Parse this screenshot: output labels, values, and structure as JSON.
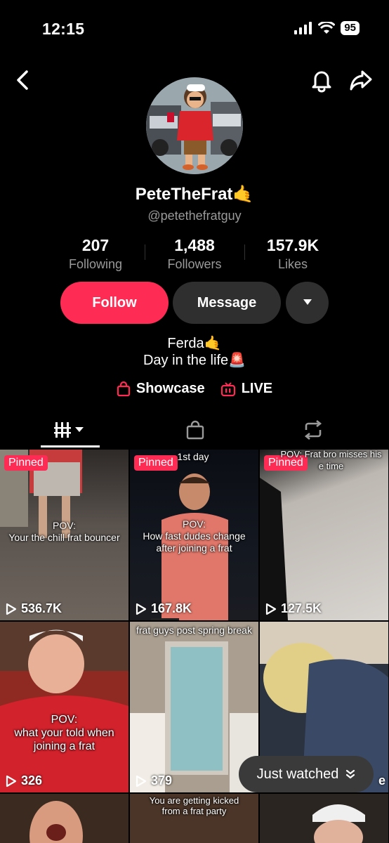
{
  "status": {
    "time": "12:15",
    "battery": "95"
  },
  "profile": {
    "username": "PeteTheFrat🤙",
    "handle": "@petethefratguy",
    "stats": [
      {
        "value": "207",
        "label": "Following"
      },
      {
        "value": "1,488",
        "label": "Followers"
      },
      {
        "value": "157.9K",
        "label": "Likes"
      }
    ],
    "follow_label": "Follow",
    "message_label": "Message",
    "bio_line1": "Ferda🤙",
    "bio_line2": "Day in the life🚨",
    "showcase_label": "Showcase",
    "live_label": "LIVE"
  },
  "colors": {
    "accent": "#fe2c55",
    "button_dark": "#2f2f2f",
    "muted": "#9a9a9a"
  },
  "videos": [
    {
      "pinned": "Pinned",
      "caption": "POV:\nYour the chill frat bouncer",
      "views": "536.7K"
    },
    {
      "pinned": "Pinned",
      "top_caption": "1st day",
      "caption": "POV:\nHow fast dudes change\nafter joining a frat",
      "views": "167.8K"
    },
    {
      "pinned": "Pinned",
      "top_caption": "POV: Frat bro misses his\ne time",
      "views": "127.5K"
    },
    {
      "caption": "POV:\nwhat your told when\njoining a frat",
      "views": "326"
    },
    {
      "top_caption": "frat guys post spring break",
      "views": "379"
    },
    {
      "views": "e"
    },
    {},
    {
      "top_caption": "You are getting kicked\nfrom a frat party"
    },
    {}
  ],
  "just_watched_label": "Just watched"
}
